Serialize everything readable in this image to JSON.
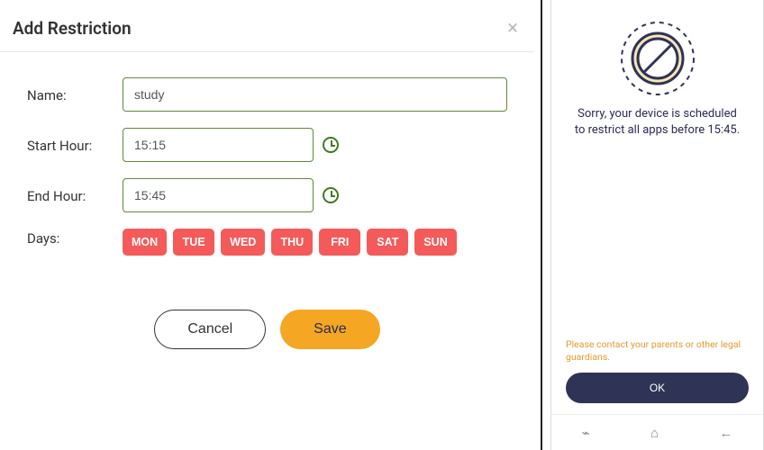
{
  "modal": {
    "title": "Add Restriction",
    "labels": {
      "name": "Name:",
      "start": "Start Hour:",
      "end": "End Hour:",
      "days": "Days:"
    },
    "fields": {
      "name_value": "study",
      "start_value": "15:15",
      "end_value": "15:45"
    },
    "days": [
      "MON",
      "TUE",
      "WED",
      "THU",
      "FRI",
      "SAT",
      "SUN"
    ],
    "actions": {
      "cancel": "Cancel",
      "save": "Save"
    }
  },
  "phone": {
    "restrict_message": "Sorry, your device is scheduled to restrict all apps before 15:45.",
    "contact_message": "Please contact your parents or other legal guardians.",
    "ok": "OK"
  }
}
